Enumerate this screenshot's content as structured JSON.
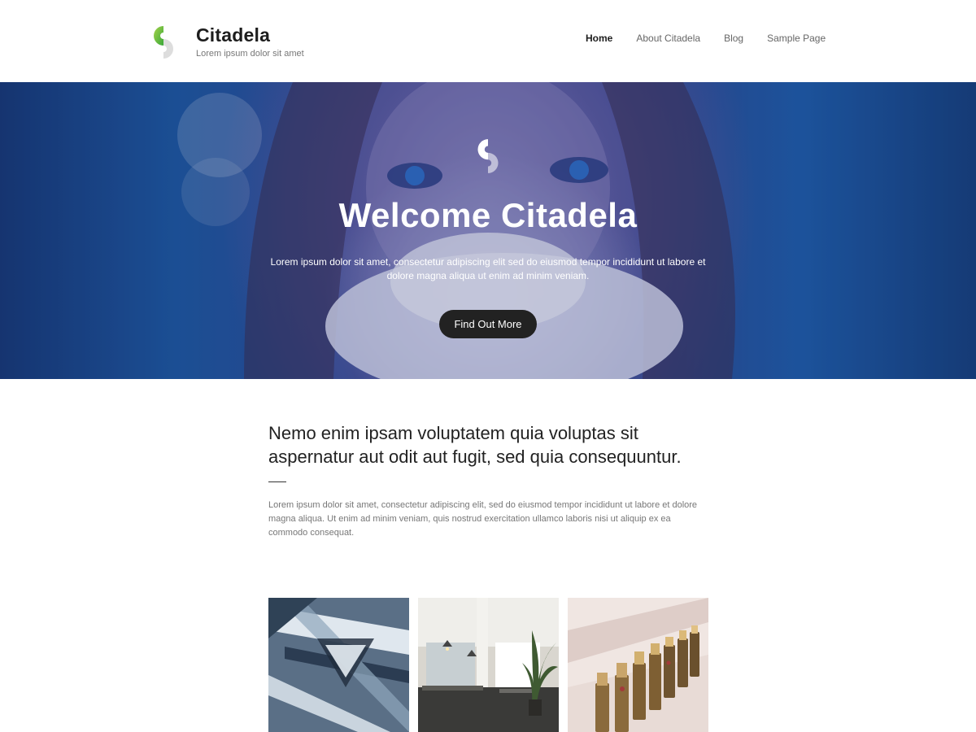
{
  "header": {
    "site_title": "Citadela",
    "tagline": "Lorem ipsum dolor sit amet",
    "logo_icon": "citadela-logo-icon",
    "nav": [
      {
        "label": "Home",
        "active": true
      },
      {
        "label": "About Citadela",
        "active": false
      },
      {
        "label": "Blog",
        "active": false
      },
      {
        "label": "Sample Page",
        "active": false
      }
    ]
  },
  "hero": {
    "title": "Welcome Citadela",
    "text": "Lorem ipsum dolor sit amet, consectetur adipiscing elit sed do eiusmod tempor incididunt ut labore et dolore magna aliqua ut enim ad minim veniam.",
    "button_label": "Find Out More",
    "logo_icon": "citadela-logo-icon"
  },
  "intro": {
    "heading": "Nemo enim ipsam voluptatem quia voluptas sit aspernatur aut odit aut fugit, sed quia consequuntur.",
    "text": "Lorem ipsum dolor sit amet, consectetur adipiscing elit, sed do eiusmod tempor incididunt ut labore et dolore magna aliqua. Ut enim ad minim veniam, quis nostrud exercitation ullamco laboris nisi ut aliquip ex ea commodo consequat."
  },
  "gallery": {
    "images": [
      "staircase-photo",
      "office-photo",
      "lipstick-photo"
    ]
  },
  "colors": {
    "accent_green": "#8dc63f",
    "dark_button": "#222222",
    "hero_blue": "#1d5aa4"
  }
}
